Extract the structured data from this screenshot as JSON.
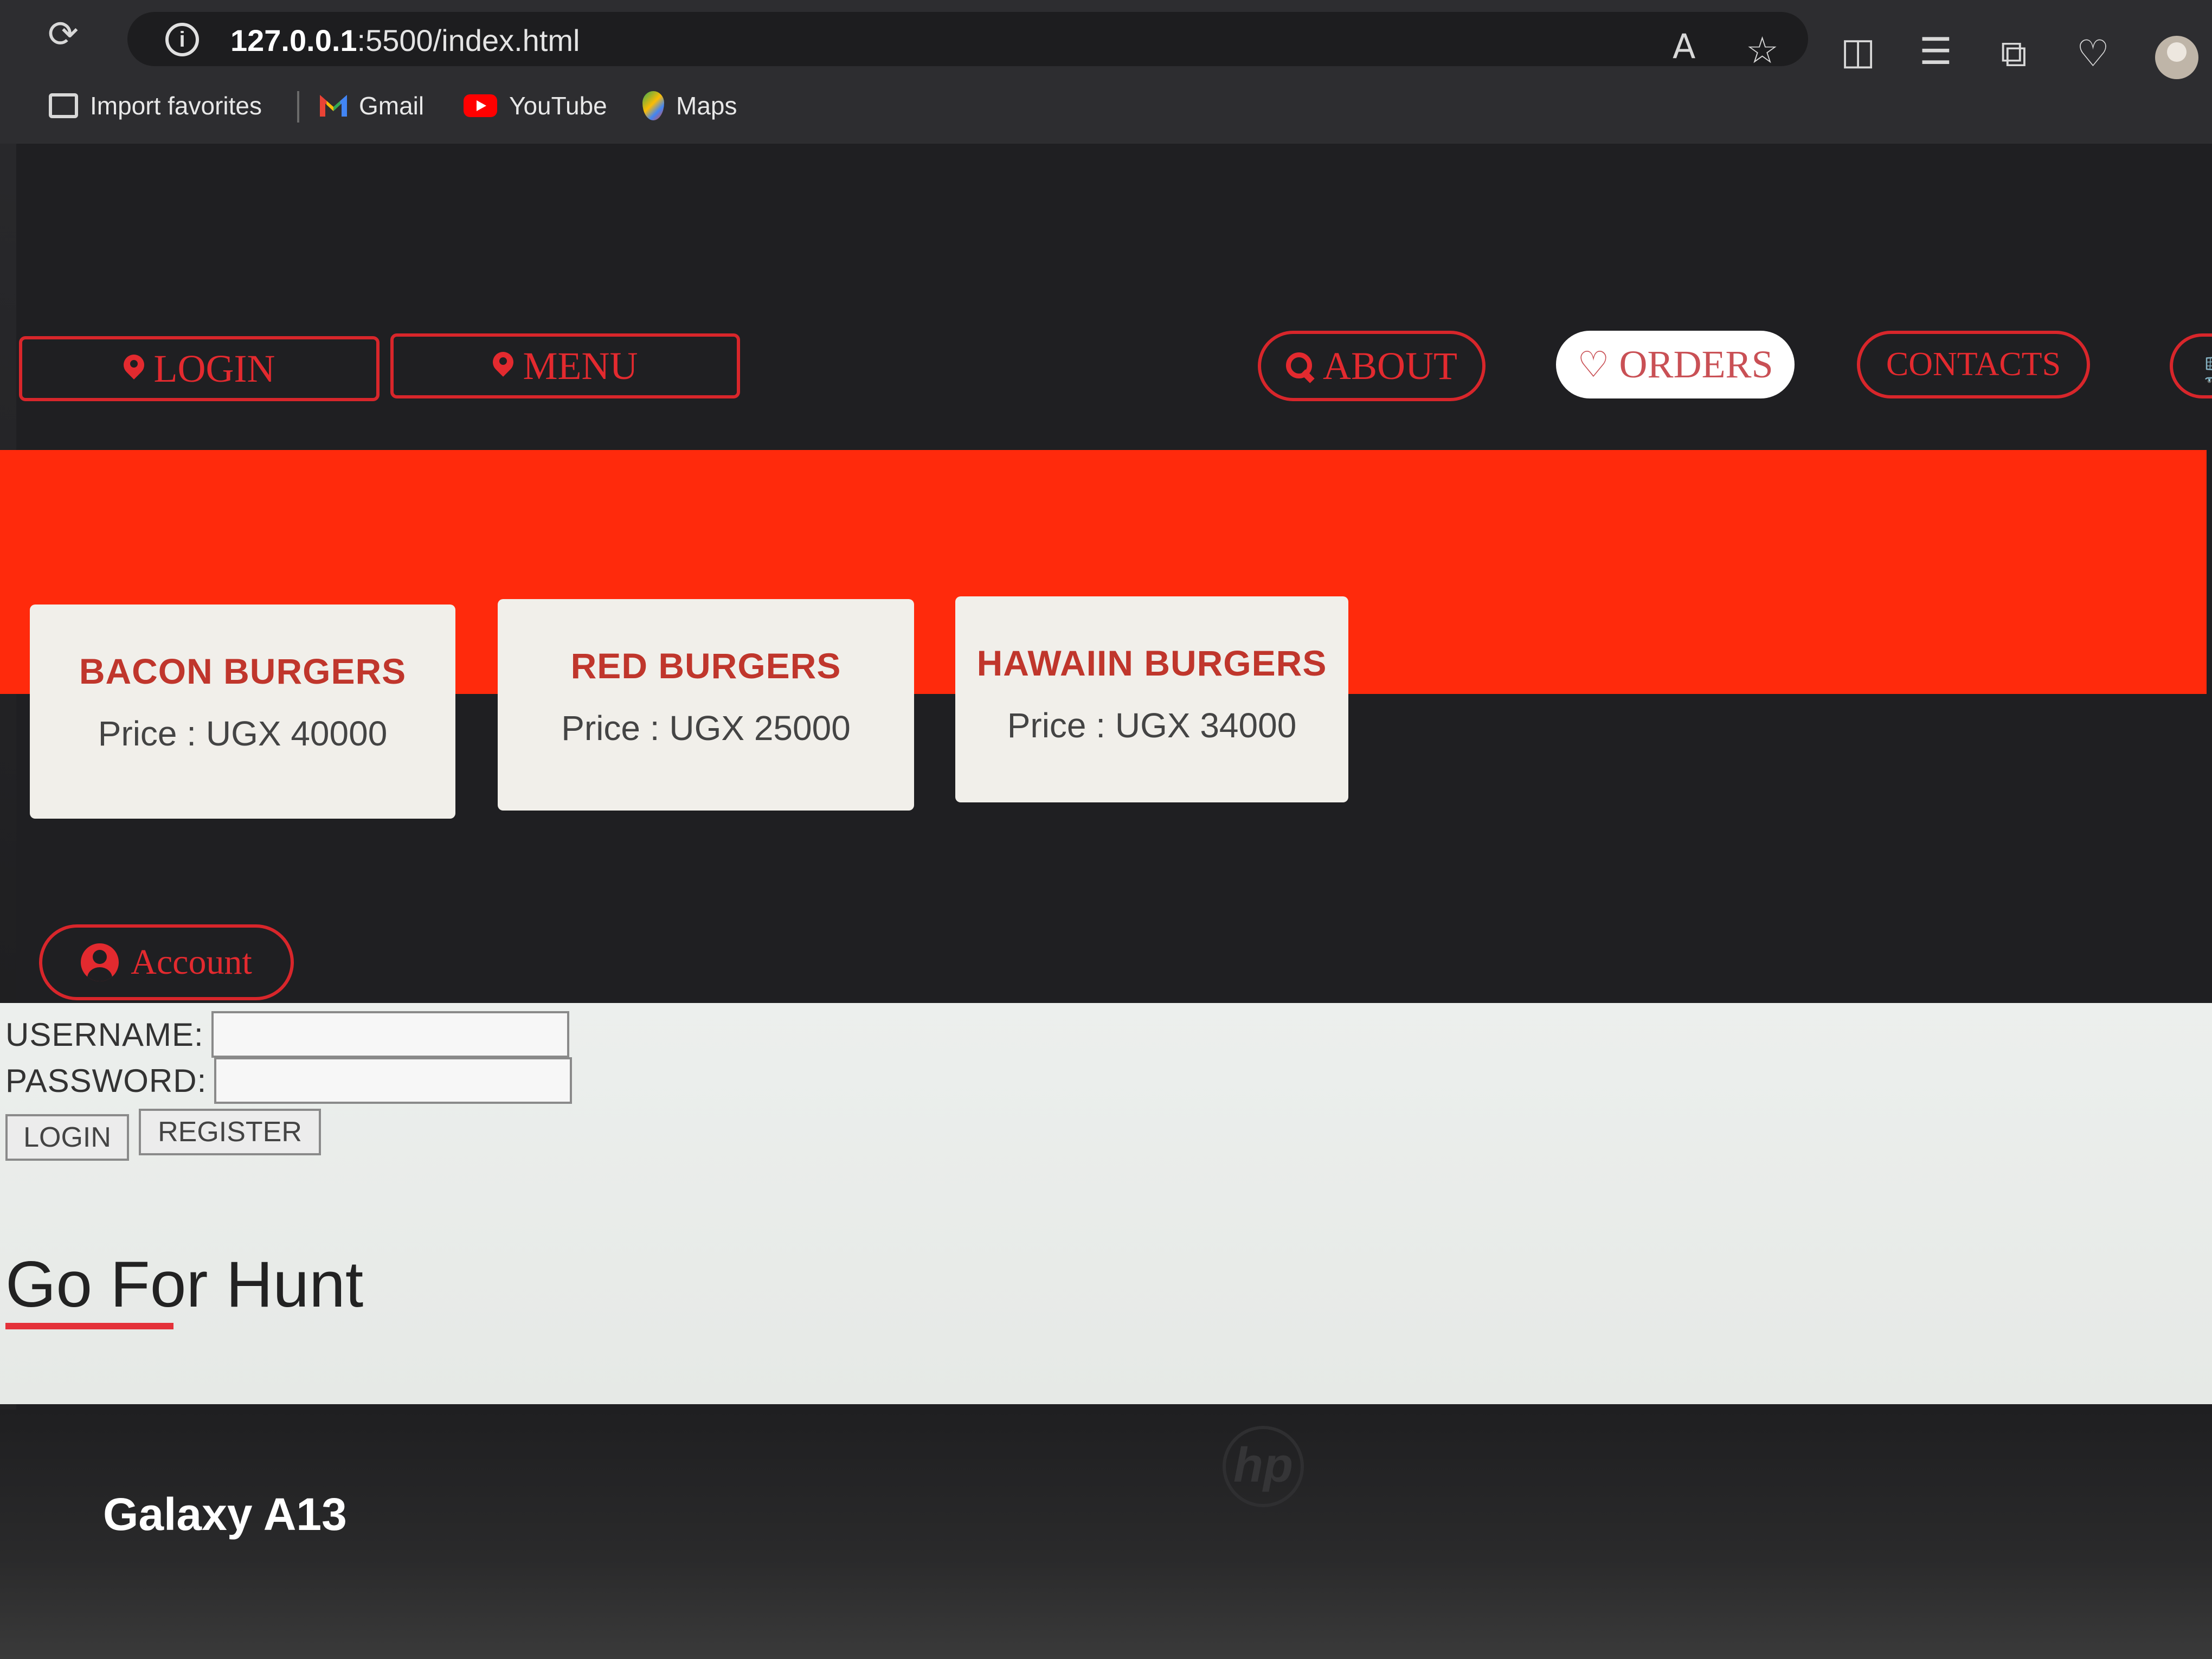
{
  "browser": {
    "url_host": "127.0.0.1",
    "url_rest": ":5500/index.html",
    "bookmarks": [
      {
        "label": "Import favorites",
        "icon": "import-favorites-icon"
      },
      {
        "label": "Gmail",
        "icon": "gmail-icon"
      },
      {
        "label": "YouTube",
        "icon": "youtube-icon"
      },
      {
        "label": "Maps",
        "icon": "maps-icon"
      }
    ]
  },
  "nav": {
    "login": "LOGIN",
    "menu": "MENU",
    "about": "ABOUT",
    "orders": "ORDERS",
    "contacts": "CONTACTS"
  },
  "products": [
    {
      "name": "BACON BURGERS",
      "price": "Price : UGX 40000"
    },
    {
      "name": "RED BURGERS",
      "price": "Price : UGX 25000"
    },
    {
      "name": "HAWAIIN BURGERS",
      "price": "Price : UGX 34000"
    }
  ],
  "account": {
    "button_label": "Account",
    "username_label": "USERNAME:",
    "password_label": "PASSWORD:",
    "login_button": "LOGIN",
    "register_button": "REGISTER"
  },
  "footer_heading": "Go For Hunt",
  "overlay": {
    "camera_label": "Galaxy A13",
    "laptop_logo": "hp"
  },
  "colors": {
    "accent_red": "#e32a2f",
    "band_red": "#ff2a0c",
    "page_dark": "#1f1f22"
  }
}
